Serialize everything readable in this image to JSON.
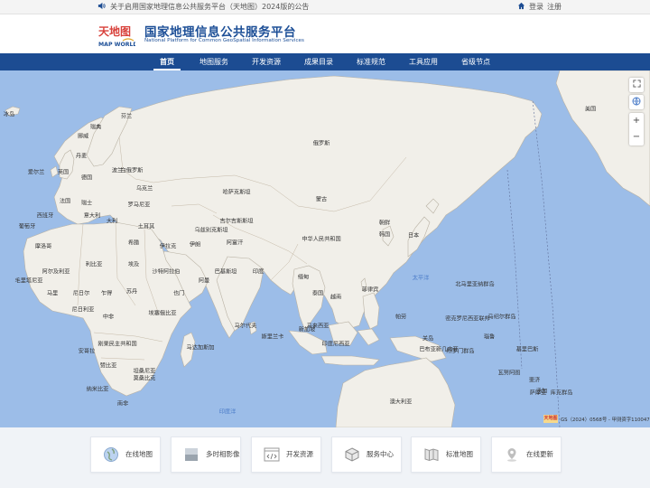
{
  "topbar": {
    "notice": "关于启用国家地理信息公共服务平台（天地图）2024版的公告",
    "login": "登录",
    "register": "注册"
  },
  "header": {
    "logo_text": "天地图",
    "logo_sub": "MAP WORLD",
    "title": "国家地理信息公共服务平台",
    "subtitle": "National Platform for Common GeoSpatial Information Services"
  },
  "nav": {
    "items": [
      "首页",
      "地图服务",
      "开发资源",
      "成果目录",
      "标准规范",
      "工具应用",
      "省级节点"
    ],
    "active": 0
  },
  "map": {
    "labels": [
      "冰岛",
      "瑞典",
      "芬兰",
      "挪威",
      "丹麦",
      "英国",
      "爱尔兰",
      "德国",
      "波兰",
      "白俄罗斯",
      "乌克兰",
      "法国",
      "瑞士",
      "意大利",
      "西班牙",
      "葡萄牙",
      "罗马尼亚",
      "大利",
      "土耳其",
      "希腊",
      "俄罗斯",
      "哈萨克斯坦",
      "蒙古",
      "乌兹别克斯坦",
      "吉尔吉斯斯坦",
      "中华人民共和国",
      "朝鲜",
      "韩国",
      "日本",
      "阿富汗",
      "巴基斯坦",
      "伊拉克",
      "伊朗",
      "沙特阿拉伯",
      "阿曼",
      "也门",
      "印度",
      "缅甸",
      "泰国",
      "越南",
      "菲律宾",
      "马来西亚",
      "印度尼西亚",
      "巴布亚新几内亚",
      "澳大利亚",
      "美国",
      "摩洛哥",
      "阿尔及利亚",
      "利比亚",
      "埃及",
      "毛里塔尼亚",
      "马里",
      "尼日尔",
      "乍得",
      "苏丹",
      "尼日利亚",
      "中非",
      "埃塞俄比亚",
      "刚果民主共和国",
      "坦桑尼亚",
      "安哥拉",
      "赞比亚",
      "纳米比亚",
      "南非",
      "莫桑比克",
      "马达加斯加",
      "马尔代夫",
      "新加坡",
      "斯里兰卡",
      "帕劳",
      "密克罗尼西亚联邦",
      "马绍尔群岛",
      "瑙鲁",
      "基里巴斯",
      "所罗门群岛",
      "瓦努阿图",
      "斐济",
      "汤加",
      "萨摩亚",
      "库克群岛",
      "关岛",
      "北马里亚纳群岛"
    ],
    "oceans": [
      "太平洋",
      "印度洋"
    ],
    "attribution": "GS（2024）0568号 - 甲测资字1100471"
  },
  "services": [
    {
      "label": "在线地图",
      "icon": "globe-icon"
    },
    {
      "label": "多时相影像",
      "icon": "imagery-icon"
    },
    {
      "label": "开发资源",
      "icon": "code-icon"
    },
    {
      "label": "服务中心",
      "icon": "box-icon"
    },
    {
      "label": "标准地图",
      "icon": "map-icon"
    },
    {
      "label": "在线更新",
      "icon": "pin-icon"
    }
  ],
  "colors": {
    "brand": "#1c4c92",
    "ocean": "#9cbde8",
    "land": "#f1efe9"
  }
}
